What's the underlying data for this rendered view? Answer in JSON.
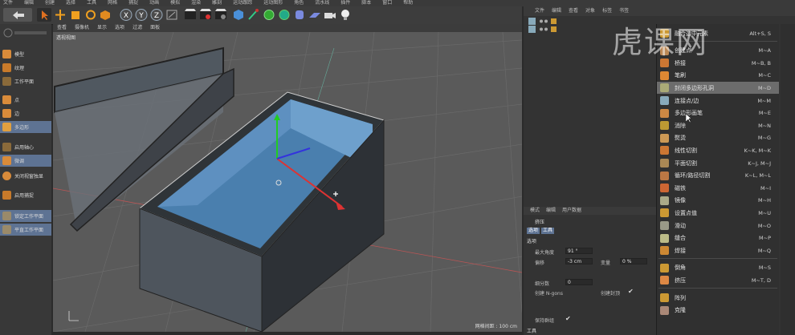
{
  "menubar": {
    "items": [
      "文件",
      "编辑",
      "创建",
      "选择",
      "工具",
      "网格",
      "捕捉",
      "动画",
      "模拟",
      "渲染",
      "雕刻",
      "运动跟踪",
      "运动图形",
      "角色",
      "流水线",
      "插件",
      "脚本",
      "窗口",
      "帮助"
    ]
  },
  "toolbar": {
    "axis_buttons": [
      "X",
      "Y",
      "Z"
    ]
  },
  "left_panel": {
    "items": [
      {
        "label": "模型"
      },
      {
        "label": "纹理"
      },
      {
        "label": "工作平面"
      },
      {
        "label": "点"
      },
      {
        "label": "边"
      },
      {
        "label": "多边形"
      },
      {
        "label": "启用轴心"
      },
      {
        "label": "微调"
      },
      {
        "label": "关闭视窗独显"
      },
      {
        "label": "启用捕捉"
      },
      {
        "label": "锁定工作平面"
      },
      {
        "label": "平直工作平面"
      }
    ]
  },
  "viewport": {
    "menu": [
      "查看",
      "摄像机",
      "显示",
      "选项",
      "过滤",
      "面板"
    ],
    "label": "透视视图",
    "status": "网格间距 : 100 cm"
  },
  "object_manager": {
    "tabs": [
      "文件",
      "编辑",
      "查看",
      "对象",
      "标签",
      "书签"
    ]
  },
  "attributes": {
    "tabs": [
      "模式",
      "编辑",
      "用户数据"
    ],
    "title": "挤压",
    "sub_tabs": [
      "选项",
      "工具"
    ],
    "section": "选项",
    "fields": [
      {
        "label": "最大角度",
        "value": "91 °"
      },
      {
        "label": "偏移",
        "value": "-3 cm"
      },
      {
        "label": "变量",
        "value": "0 %"
      },
      {
        "label": "细分数",
        "value": "0"
      },
      {
        "label": "创建 N-gons",
        "value": ""
      },
      {
        "label": "创建封顶",
        "value": ""
      },
      {
        "label": "保持群组",
        "value": ""
      },
      {
        "label": "工具",
        "value": ""
      }
    ]
  },
  "context_menu": {
    "items": [
      {
        "label": "融合选中元素",
        "shortcut": "Alt+S, S"
      },
      {
        "label": "创建点",
        "shortcut": "M~A"
      },
      {
        "label": "桥接",
        "shortcut": "M~B, B"
      },
      {
        "label": "笔刷",
        "shortcut": "M~C"
      },
      {
        "label": "封闭多边形孔洞",
        "shortcut": "M~D",
        "highlighted": true
      },
      {
        "label": "连接点/边",
        "shortcut": "M~M"
      },
      {
        "label": "多边形画笔",
        "shortcut": "M~E"
      },
      {
        "label": "消除",
        "shortcut": "M~N"
      },
      {
        "label": "熨烫",
        "shortcut": "M~G"
      },
      {
        "label": "线性切割",
        "shortcut": "K~K, M~K"
      },
      {
        "label": "平面切割",
        "shortcut": "K~J, M~J"
      },
      {
        "label": "循环/路径切割",
        "shortcut": "K~L, M~L"
      },
      {
        "label": "磁铁",
        "shortcut": "M~I"
      },
      {
        "label": "镜像",
        "shortcut": "M~H"
      },
      {
        "label": "设置点值",
        "shortcut": "M~U"
      },
      {
        "label": "滑动",
        "shortcut": "M~O"
      },
      {
        "label": "缝合",
        "shortcut": "M~P"
      },
      {
        "label": "焊接",
        "shortcut": "M~Q"
      },
      {
        "label": "倒角",
        "shortcut": "M~S"
      },
      {
        "label": "挤压",
        "shortcut": "M~T, D"
      },
      {
        "label": "阵列",
        "shortcut": ""
      },
      {
        "label": "克隆",
        "shortcut": ""
      }
    ]
  },
  "watermark": "虎课网"
}
